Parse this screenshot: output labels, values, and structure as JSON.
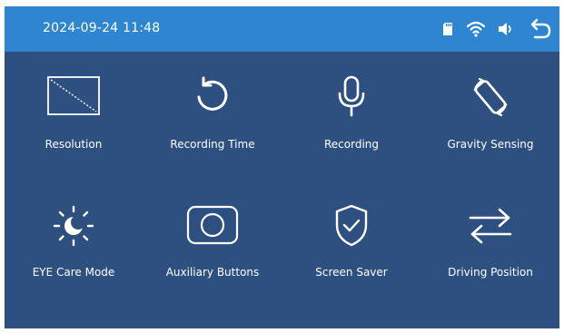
{
  "status_bar": {
    "datetime": "2024-09-24 11:48",
    "icons": [
      "sd-card-icon",
      "wifi-icon",
      "speaker-icon",
      "back-arrow-icon"
    ]
  },
  "settings": {
    "items": [
      {
        "label": "Resolution",
        "icon": "resolution-icon"
      },
      {
        "label": "Recording Time",
        "icon": "rotate-ccw-icon"
      },
      {
        "label": "Recording",
        "icon": "microphone-icon"
      },
      {
        "label": "Gravity Sensing",
        "icon": "screen-rotate-icon"
      },
      {
        "label": "EYE Care Mode",
        "icon": "sun-moon-icon"
      },
      {
        "label": "Auxiliary Buttons",
        "icon": "circle-button-icon"
      },
      {
        "label": "Screen Saver",
        "icon": "shield-check-icon"
      },
      {
        "label": "Driving Position",
        "icon": "swap-arrows-icon"
      }
    ]
  },
  "colors": {
    "topbar": "#2f86d0",
    "background": "#2d5080",
    "foreground": "#ffffff"
  }
}
